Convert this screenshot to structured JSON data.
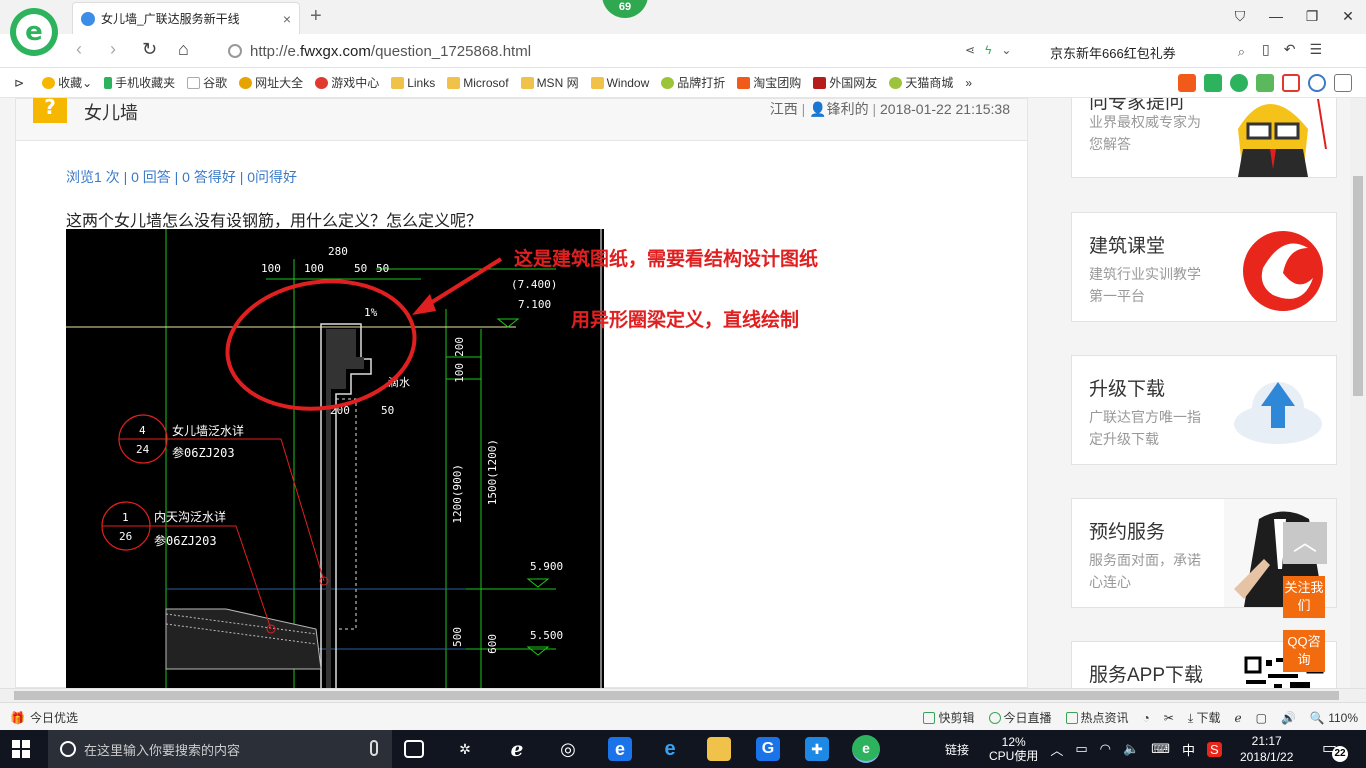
{
  "browser": {
    "badge_count": "69",
    "tab_title": "女儿墙_广联达服务新干线",
    "tab_close": "×",
    "new_tab": "+",
    "url_prefix": "http://e.",
    "url_domain": "fwxgx.com",
    "url_path": "/question_1725868.html",
    "search_text": "京东新年666红包礼券",
    "bookmarks": [
      "收藏",
      "手机收藏夹",
      "谷歌",
      "网址大全",
      "游戏中心",
      "Links",
      "Microsof",
      "MSN 网",
      "Window",
      "品牌打折",
      "淘宝团购",
      "外国网友",
      "天猫商城"
    ],
    "bookmark_more": "»"
  },
  "question": {
    "title": "女儿墙",
    "region": "江西",
    "author": "锋利的",
    "datetime": "2018-01-22 21:15:38",
    "stats": "浏览1 次 | 0 回答 | 0 答得好 | 0问得好",
    "text": "这两个女儿墙怎么没有设钢筋，用什么定义？怎么定义呢？"
  },
  "drawing": {
    "annotation_1": "这是建筑图纸，需要看结构设计图纸",
    "annotation_2": "用异形圈梁定义，直线绘制",
    "dims": [
      "280",
      "100",
      "100",
      "50",
      "50",
      "(7.400)",
      "7.100",
      "1%",
      "200",
      "100",
      "200",
      "50",
      "1200(900)",
      "1500(1200)",
      "5.900",
      "5.500",
      "500",
      "600"
    ],
    "drip_label": "滴水",
    "detail_1": {
      "num": "4",
      "sheet": "24",
      "title": "女儿墙泛水详",
      "ref": "参06ZJ203"
    },
    "detail_2": {
      "num": "1",
      "sheet": "26",
      "title": "内天沟泛水详",
      "ref": "参06ZJ203"
    }
  },
  "sidebar": {
    "cards": [
      {
        "title": "向专家提问",
        "desc": "业界最权威专家为您解答"
      },
      {
        "title": "建筑课堂",
        "desc": "建筑行业实训教学第一平台"
      },
      {
        "title": "升级下载",
        "desc": "广联达官方唯一指定升级下载"
      },
      {
        "title": "预约服务",
        "desc": "服务面对面，承诺心连心"
      },
      {
        "title": "服务APP下载",
        "desc": ""
      }
    ],
    "back_top": "︿",
    "follow_label": "关注我们",
    "qq_label": "QQ咨询"
  },
  "statusbar": {
    "left": "今日优选",
    "items": [
      "快剪辑",
      "今日直播",
      "热点资讯",
      "下载"
    ],
    "zoom": "110%"
  },
  "taskbar": {
    "search_placeholder": "在这里输入你要搜索的内容",
    "link_label": "链接",
    "cpu_percent": "12%",
    "cpu_label": "CPU使用",
    "ime": "中",
    "time": "21:17",
    "date": "2018/1/22",
    "notifications": "22"
  }
}
